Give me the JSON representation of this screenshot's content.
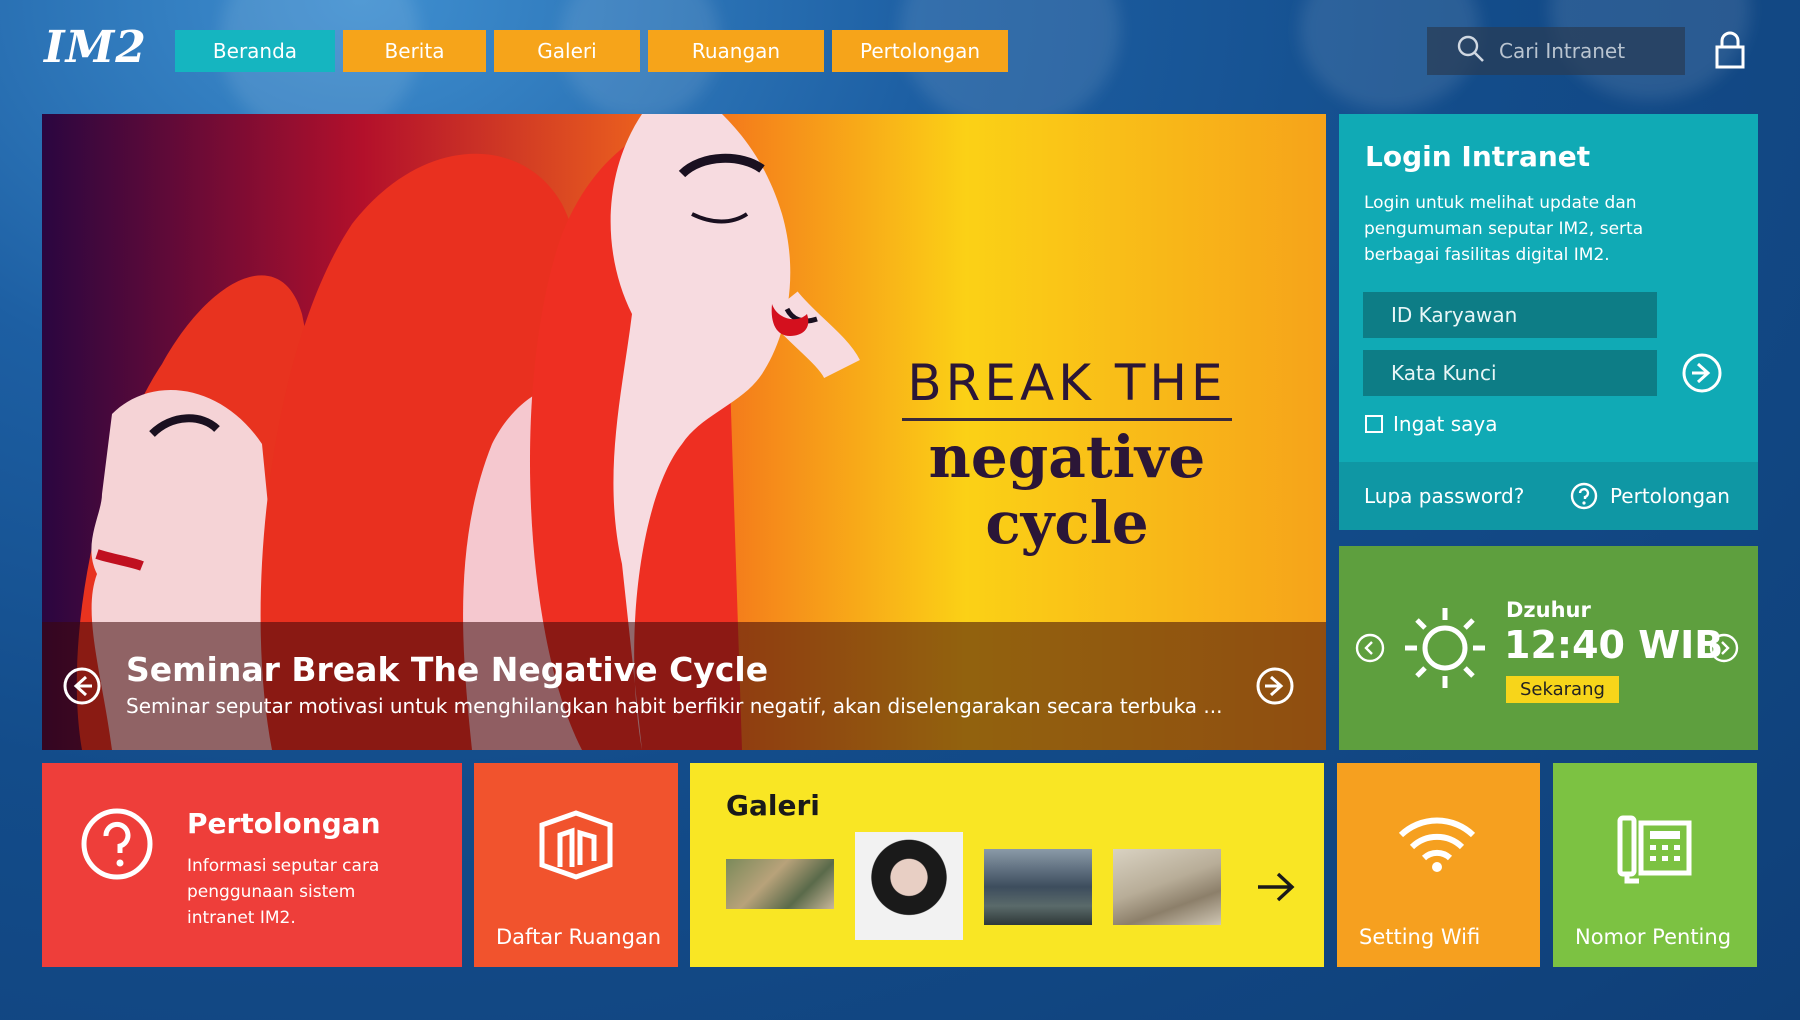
{
  "header": {
    "logo": "IM2",
    "nav": [
      {
        "label": "Beranda",
        "active": true
      },
      {
        "label": "Berita",
        "active": false
      },
      {
        "label": "Galeri",
        "active": false
      },
      {
        "label": "Ruangan",
        "active": false
      },
      {
        "label": "Pertolongan",
        "active": false
      }
    ],
    "search_placeholder": "Cari Intranet",
    "icons": [
      "search-icon",
      "lock-icon"
    ]
  },
  "hero": {
    "image_text_line1": "BREAK THE",
    "image_text_line2a": "negative",
    "image_text_line2b": "cycle",
    "title": "Seminar Break The Negative Cycle",
    "description": "Seminar seputar motivasi untuk menghilangkan habit berfikir negatif, akan diselengarakan secara terbuka ..."
  },
  "login": {
    "title": "Login Intranet",
    "description": "Login untuk melihat update dan pengumuman seputar IM2, serta berbagai fasilitas digital IM2.",
    "id_placeholder": "ID Karyawan",
    "password_placeholder": "Kata Kunci",
    "remember_label": "Ingat saya",
    "forgot_label": "Lupa password?",
    "help_label": "Pertolongan"
  },
  "prayer": {
    "name": "Dzuhur",
    "time": "12:40 WIB",
    "badge": "Sekarang"
  },
  "tiles": {
    "help_title": "Pertolongan",
    "help_desc": "Informasi seputar cara penggunaan sistem intranet IM2.",
    "rooms_label": "Daftar Ruangan",
    "gallery_title": "Galeri",
    "wifi_label": "Setting Wifi",
    "phone_label": "Nomor Penting"
  },
  "colors": {
    "nav_active": "#15b5c0",
    "nav_inactive": "#f6a41a",
    "login_bg": "#10aab5",
    "prayer_bg": "#5e9f3e",
    "help_tile": "#ee3e3a",
    "rooms_tile": "#f1532d",
    "gallery_tile": "#f9e624",
    "wifi_tile": "#f6a01f",
    "phone_tile": "#7cc242"
  }
}
